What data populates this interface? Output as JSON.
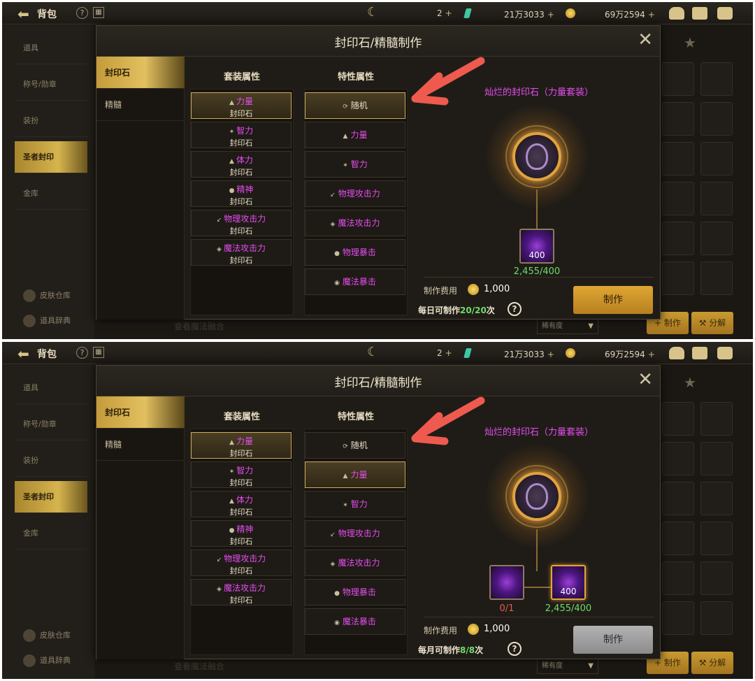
{
  "screens": [
    {
      "topbar": {
        "title": "背包",
        "res_gems": "2",
        "res_gold": "21万3033",
        "res_bound": "69万2594"
      },
      "bg_menu": [
        "道具",
        "称号/勋章",
        "装扮",
        "圣者封印",
        "金库"
      ],
      "bg_menu_active": 3,
      "bg_links": [
        "皮肤仓库",
        "道具辞典"
      ],
      "bg_buttons": [
        "制作",
        "分解"
      ],
      "bg_sort": "稀有度",
      "bg_footer": "查看魔法融合",
      "dialog": {
        "title": "封印石/精髓制作",
        "tabs": [
          "封印石",
          "精髓"
        ],
        "set_header": "套装属性",
        "attr_header": "特性属性",
        "set_items": [
          {
            "name": "力量",
            "sub": "封印石",
            "icon": "strength-icon"
          },
          {
            "name": "智力",
            "sub": "封印石",
            "icon": "intellect-icon"
          },
          {
            "name": "体力",
            "sub": "封印石",
            "icon": "vitality-icon"
          },
          {
            "name": "精神",
            "sub": "封印石",
            "icon": "spirit-icon"
          },
          {
            "name": "物理攻击力",
            "sub": "封印石",
            "icon": "physical-attack-icon"
          },
          {
            "name": "魔法攻击力",
            "sub": "封印石",
            "icon": "magic-attack-icon"
          }
        ],
        "set_selected": 0,
        "attr_items": [
          "随机",
          "力量",
          "智力",
          "物理攻击力",
          "魔法攻击力",
          "物理暴击",
          "魔法暴击"
        ],
        "attr_selected": 0,
        "preview_title": "灿烂的封印石（力量套装）",
        "materials": [
          {
            "qty_badge": "400",
            "count": "2,455/400",
            "count_color": "green"
          }
        ],
        "cost_label": "制作费用",
        "cost_value": "1,000",
        "limit_prefix": "每日可制作",
        "limit_value": "20/20",
        "limit_suffix": "次",
        "make_label": "制作",
        "make_enabled": true
      }
    },
    {
      "topbar": {
        "title": "背包",
        "res_gems": "2",
        "res_gold": "21万3033",
        "res_bound": "69万2594"
      },
      "bg_menu": [
        "道具",
        "称号/勋章",
        "装扮",
        "圣者封印",
        "金库"
      ],
      "bg_menu_active": 3,
      "bg_links": [
        "皮肤仓库",
        "道具辞典"
      ],
      "bg_buttons": [
        "制作",
        "分解"
      ],
      "bg_sort": "稀有度",
      "bg_footer": "查看魔法融合",
      "dialog": {
        "title": "封印石/精髓制作",
        "tabs": [
          "封印石",
          "精髓"
        ],
        "set_header": "套装属性",
        "attr_header": "特性属性",
        "set_items": [
          {
            "name": "力量",
            "sub": "封印石",
            "icon": "strength-icon"
          },
          {
            "name": "智力",
            "sub": "封印石",
            "icon": "intellect-icon"
          },
          {
            "name": "体力",
            "sub": "封印石",
            "icon": "vitality-icon"
          },
          {
            "name": "精神",
            "sub": "封印石",
            "icon": "spirit-icon"
          },
          {
            "name": "物理攻击力",
            "sub": "封印石",
            "icon": "physical-attack-icon"
          },
          {
            "name": "魔法攻击力",
            "sub": "封印石",
            "icon": "magic-attack-icon"
          }
        ],
        "set_selected": 0,
        "attr_items": [
          "随机",
          "力量",
          "智力",
          "物理攻击力",
          "魔法攻击力",
          "物理暴击",
          "魔法暴击"
        ],
        "attr_selected": 1,
        "preview_title": "灿烂的封印石（力量套装）",
        "materials": [
          {
            "qty_badge": "",
            "count": "0/1",
            "count_color": "red"
          },
          {
            "qty_badge": "400",
            "count": "2,455/400",
            "count_color": "green"
          }
        ],
        "cost_label": "制作费用",
        "cost_value": "1,000",
        "limit_prefix": "每月可制作",
        "limit_value": "8/8",
        "limit_suffix": "次",
        "make_label": "制作",
        "make_enabled": false
      }
    }
  ],
  "colors": {
    "accent_gold": "#d6b44e",
    "purple_text": "#e54df0",
    "green_text": "#6fdc6a",
    "red_text": "#e85a50",
    "annotation_arrow": "#ef5a4f"
  }
}
